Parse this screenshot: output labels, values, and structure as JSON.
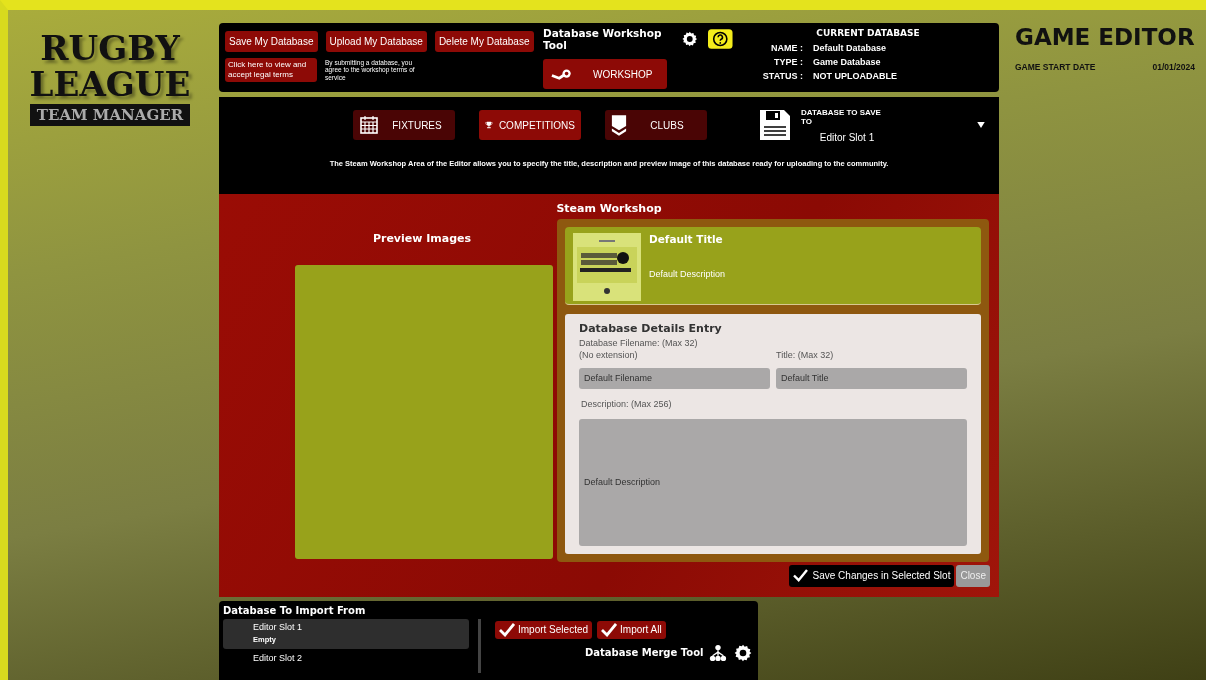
{
  "logo": {
    "line_1": "RUGBY",
    "line_2": "LEAGUE",
    "subtitle": "TEAM MANAGER"
  },
  "toolbar": {
    "buttons": [
      "Save My Database",
      "Upload My Database",
      "Delete My Database"
    ],
    "legal_button": "Click here to view and accept legal terms",
    "legal_note": "By submitting a database, you agree to the workshop terms of service"
  },
  "workshop_tool": {
    "title": "Database Workshop Tool",
    "button": "WORKSHOP"
  },
  "current_database": {
    "heading": "CURRENT DATABASE",
    "rows": [
      {
        "label": "NAME :",
        "value": "Default Database"
      },
      {
        "label": "TYPE :",
        "value": "Game Database"
      },
      {
        "label": "STATUS :",
        "value": "NOT UPLOADABLE"
      }
    ]
  },
  "game_editor": {
    "title": "GAME EDITOR",
    "start_date_label": "GAME START DATE",
    "start_date": "01/01/2024"
  },
  "nav": [
    {
      "label": "FIXTURES",
      "kind": "calendar",
      "selected": false
    },
    {
      "label": "COMPETITIONS",
      "kind": "trophy",
      "selected": true
    },
    {
      "label": "CLUBS",
      "kind": "chevron",
      "selected": false
    }
  ],
  "save_target": {
    "label": "DATABASE TO SAVE TO",
    "value": "Editor Slot 1"
  },
  "info_text": "The Steam Workshop Area of the Editor allows you to specify the title, description and preview image of this database ready for uploading to the community.",
  "workshop": {
    "title": "Steam Workshop",
    "preview_heading": "Preview Images",
    "card": {
      "title": "Default Title",
      "description": "Default Description"
    },
    "form": {
      "heading": "Database Details Entry",
      "filename_label": "Database Filename: (Max 32)",
      "filename_note": "(No extension)",
      "filename": "Default Filename",
      "title_label": "Title: (Max 32)",
      "title": "Default Title",
      "description_label": "Description: (Max 256)",
      "description": "Default Description"
    }
  },
  "actions": {
    "save": "Save Changes in Selected Slot",
    "close": "Close"
  },
  "import": {
    "title": "Database To Import From",
    "slots": [
      {
        "name": "Editor Slot 1",
        "status": "Empty",
        "selected": true
      },
      {
        "name": "Editor Slot 2",
        "selected": false
      }
    ],
    "buttons": [
      "Import Selected",
      "Import All"
    ],
    "merge_tool": "Database Merge Tool"
  }
}
